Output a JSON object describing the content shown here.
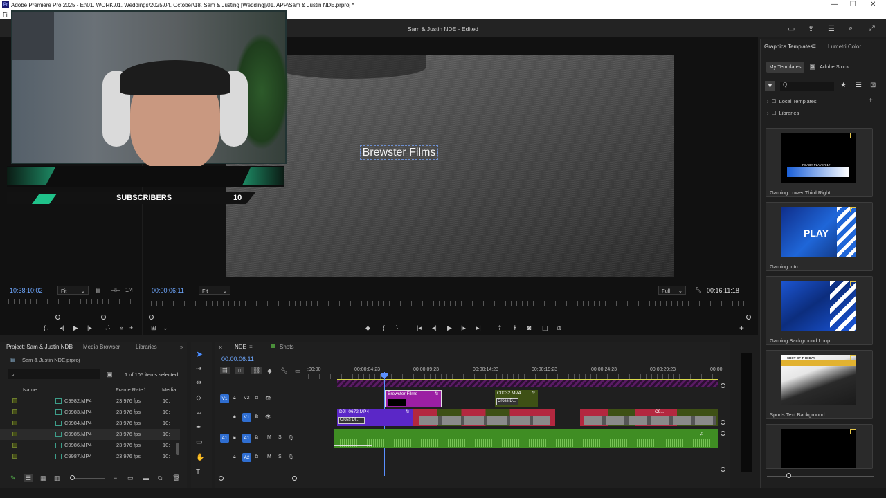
{
  "window": {
    "title": "Adobe Premiere Pro 2025 - E:\\01. WORK\\01. Weddings\\2025\\04. October\\18. Sam & Justing [Wedding]\\01. APP\\Sam & Justin NDE.prproj *",
    "logo": "Pr",
    "menu_first": "Fi",
    "sequence_title": "Sam & Justin NDE - Edited"
  },
  "overlay": {
    "subscribers_label": "SUBSCRIBERS",
    "subscribers_count": "10"
  },
  "program": {
    "graphic_text": "Brewster Films"
  },
  "source_monitor": {
    "timecode": "10:38:10:02",
    "fit": "Fit",
    "fraction": "1/4"
  },
  "program_monitor": {
    "timecode": "00:00:06:11",
    "fit": "Fit",
    "quality": "Full",
    "duration": "00:16:11:18"
  },
  "right_panel": {
    "tab_graphics": "Graphics Templates",
    "tab_lumetri": "Lumetri Color",
    "btn_my_templates": "My Templates",
    "btn_adobe_stock": "Adobe Stock",
    "search_placeholder": "Q",
    "tree": [
      "Local Templates",
      "Libraries"
    ],
    "templates": [
      {
        "label": "Gaming Lower Third Right",
        "thumb_text": "READY PLAYER 1?"
      },
      {
        "label": "Gaming Intro",
        "thumb_text": "PLAY"
      },
      {
        "label": "Gaming Background Loop",
        "thumb_text": ""
      },
      {
        "label": "Sports Text Background",
        "thumb_text": "SHOT OF THE DAY"
      },
      {
        "label": "",
        "thumb_text": ""
      }
    ]
  },
  "project": {
    "tab_project": "Project: Sam & Justin NDE",
    "tab_media": "Media Browser",
    "tab_libraries": "Libraries",
    "file": "Sam & Justin NDE.prproj",
    "selection": "1 of 105 items selected",
    "col_name": "Name",
    "col_fps": "Frame Rate",
    "col_media": "Media",
    "rows": [
      {
        "name": "C9982.MP4",
        "fps": "23.976 fps",
        "media": "10:"
      },
      {
        "name": "C9983.MP4",
        "fps": "23.976 fps",
        "media": "10:"
      },
      {
        "name": "C9984.MP4",
        "fps": "23.976 fps",
        "media": "10:"
      },
      {
        "name": "C9985.MP4",
        "fps": "23.976 fps",
        "media": "10:"
      },
      {
        "name": "C9986.MP4",
        "fps": "23.976 fps",
        "media": "10:"
      },
      {
        "name": "C9987.MP4",
        "fps": "23.976 fps",
        "media": "10:"
      }
    ]
  },
  "timeline": {
    "tab_nde": "NDE",
    "tab_shots": "Shots",
    "timecode": "00:00:06:11",
    "ticks": [
      ":00:00",
      "00:00:04:23",
      "00:00:09:23",
      "00:00:14:23",
      "00:00:19:23",
      "00:00:24:23",
      "00:00:29:23",
      "00:00"
    ],
    "tracks": {
      "v2": "V2",
      "v1": "V1",
      "a1": "A1",
      "a2": "A2",
      "v1_src": "V1",
      "a1_src": "A1"
    },
    "clips": {
      "brewster": "Brewster Films",
      "c0032": "C0032.MP4",
      "cross1": "Cross D...",
      "dji": "DJI_0672.MP4",
      "cross2": "Cross Di...",
      "c9": "C9..."
    }
  },
  "colors": {
    "accent_blue": "#6fa8ff",
    "clip_magenta": "#9b1fa3",
    "clip_purple": "#5b27c7",
    "clip_red": "#b3283f",
    "audio_green": "#3f8d23"
  }
}
